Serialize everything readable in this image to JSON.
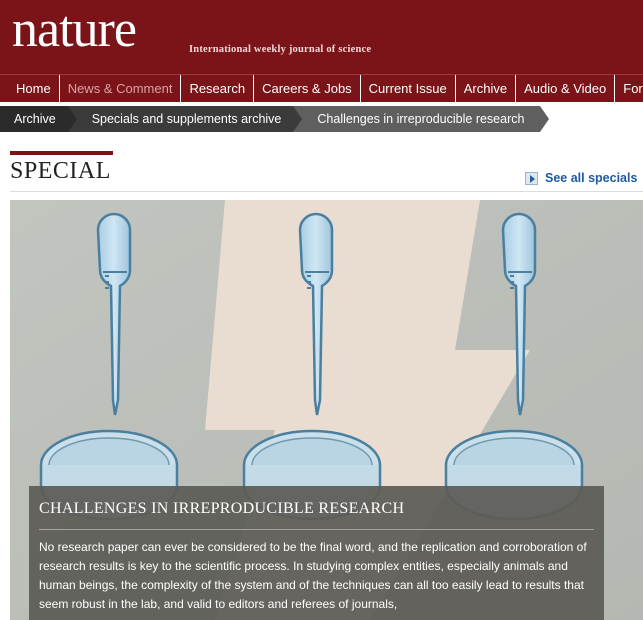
{
  "header": {
    "logo": "nature",
    "tagline": "International weekly journal of science"
  },
  "nav": {
    "items": [
      {
        "label": "Home"
      },
      {
        "label": "News & Comment"
      },
      {
        "label": "Research"
      },
      {
        "label": "Careers & Jobs"
      },
      {
        "label": "Current Issue"
      },
      {
        "label": "Archive"
      },
      {
        "label": "Audio & Video"
      },
      {
        "label": "For"
      }
    ]
  },
  "breadcrumb": [
    {
      "label": "Archive"
    },
    {
      "label": "Specials and supplements archive"
    },
    {
      "label": "Challenges in irreproducible research"
    }
  ],
  "section": {
    "title": "SPECIAL",
    "see_all": "See all specials"
  },
  "feature": {
    "title": "CHALLENGES IN IRREPRODUCIBLE RESEARCH",
    "body": "No research paper can ever be considered to be the final word, and the replication and corroboration of research results is key to the scientific process. In studying complex entities, especially animals and human beings, the complexity of the system and of the techniques can all too easily lead to results that seem robust in the lab, and valid to editors and referees of journals,"
  },
  "colors": {
    "brand": "#7a1418",
    "link": "#1f5aa1"
  }
}
